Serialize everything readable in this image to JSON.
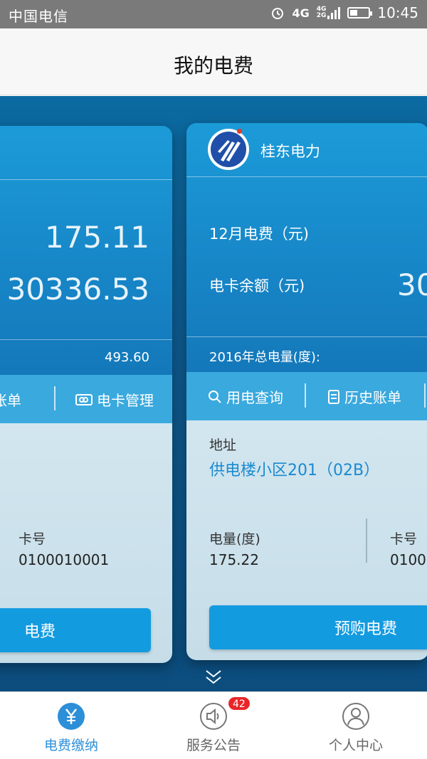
{
  "status_bar": {
    "carrier": "中国电信",
    "network": "4G",
    "network_small_top": "4G",
    "network_small_bottom": "2G",
    "time": "10:45"
  },
  "header": {
    "title": "我的电费"
  },
  "cards": [
    {
      "month_fee": "175.11",
      "balance": "30336.53",
      "total_power": "493.60",
      "actions": [
        "账单",
        "电卡管理"
      ],
      "card_no_label": "卡号",
      "card_no": "0100010001",
      "cta_label": "电费"
    },
    {
      "brand": "桂东电力",
      "month_fee_label": "12月电费（元)",
      "balance_label": "电卡余额（元)",
      "balance_partial": "30",
      "total_label": "2016年总电量(度):",
      "actions": [
        "用电查询",
        "历史账单"
      ],
      "address_label": "地址",
      "address": "供电楼小区201（02B）",
      "power_label": "电量(度)",
      "power_value": "175.22",
      "card_no_label": "卡号",
      "card_no_partial": "0100",
      "cta_label": "预购电费"
    }
  ],
  "tabbar": {
    "tabs": [
      {
        "label": "电费缴纳",
        "icon": "yen-icon",
        "active": true
      },
      {
        "label": "服务公告",
        "icon": "speaker-icon",
        "badge": "42"
      },
      {
        "label": "个人中心",
        "icon": "person-icon"
      }
    ]
  },
  "colors": {
    "accent": "#2d8fd8",
    "badge": "#e8262a",
    "card_blue": "#1787c8"
  }
}
